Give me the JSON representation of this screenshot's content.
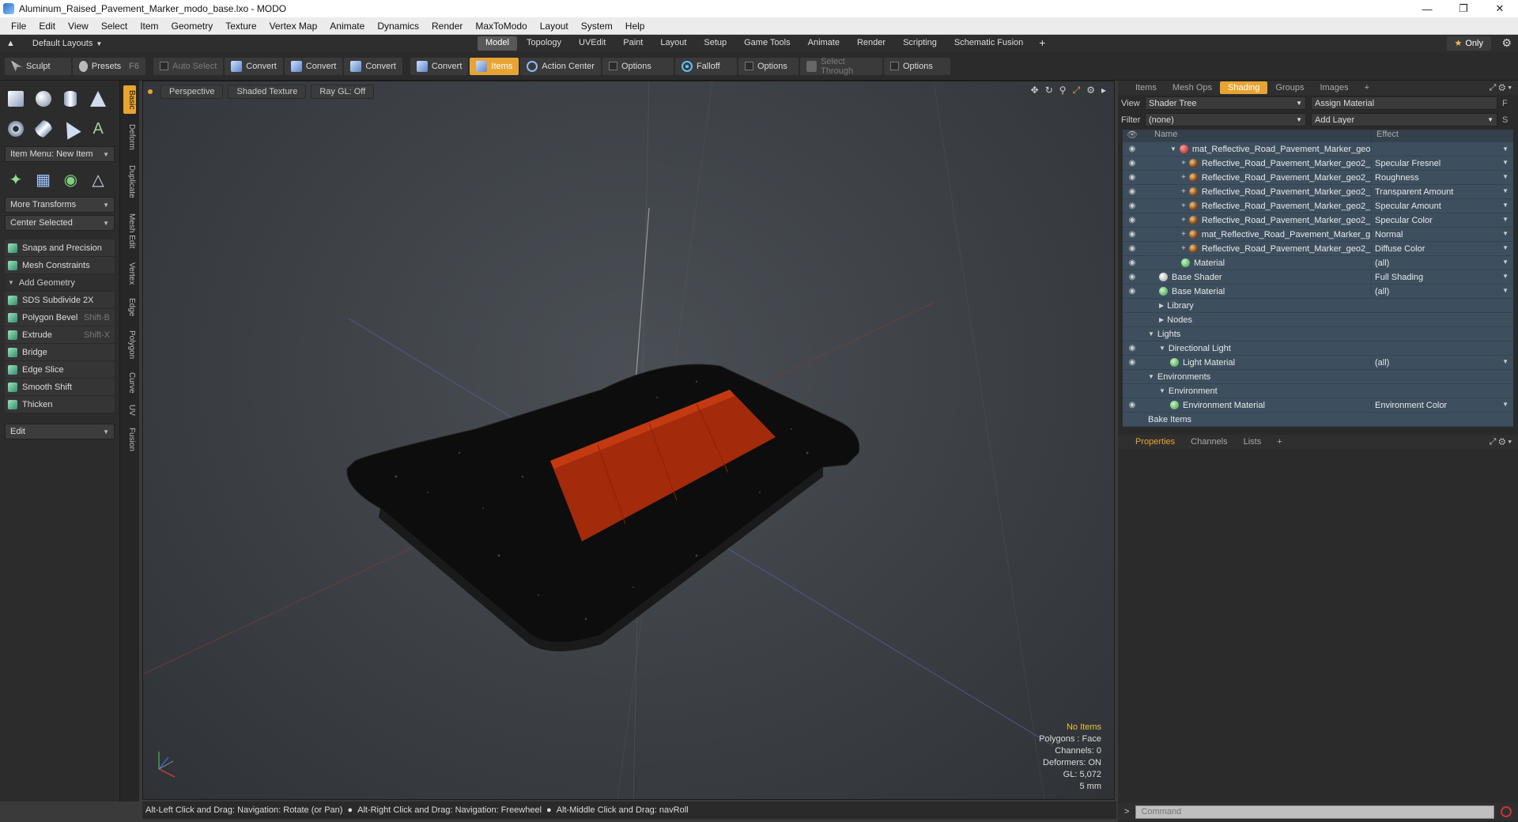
{
  "window": {
    "title": "Aluminum_Raised_Pavement_Marker_modo_base.lxo - MODO"
  },
  "menu": [
    "File",
    "Edit",
    "View",
    "Select",
    "Item",
    "Geometry",
    "Texture",
    "Vertex Map",
    "Animate",
    "Dynamics",
    "Render",
    "MaxToModo",
    "Layout",
    "System",
    "Help"
  ],
  "layoutbar": {
    "layouts_label": "Default Layouts",
    "tabs": [
      "Model",
      "Topology",
      "UVEdit",
      "Paint",
      "Layout",
      "Setup",
      "Game Tools",
      "Animate",
      "Render",
      "Scripting",
      "Schematic Fusion"
    ],
    "active_tab": "Model",
    "only_label": "Only"
  },
  "toolbar": {
    "sculpt": "Sculpt",
    "presets": "Presets",
    "presets_key": "F6",
    "auto_select": "Auto Select",
    "convert1": "Convert",
    "convert2": "Convert",
    "convert3": "Convert",
    "convert4": "Convert",
    "items": "Items",
    "action_center": "Action Center",
    "options1": "Options",
    "falloff": "Falloff",
    "options2": "Options",
    "select_through": "Select Through",
    "options3": "Options"
  },
  "toolbox": {
    "item_menu": "Item Menu: New Item",
    "more_transforms": "More Transforms",
    "center_selected": "Center Selected",
    "snaps": "Snaps and Precision",
    "mesh_constraints": "Mesh Constraints",
    "add_geometry": "Add Geometry",
    "tools": [
      {
        "label": "SDS Subdivide 2X",
        "key": ""
      },
      {
        "label": "Polygon Bevel",
        "key": "Shift-B"
      },
      {
        "label": "Extrude",
        "key": "Shift-X"
      },
      {
        "label": "Bridge",
        "key": ""
      },
      {
        "label": "Edge Slice",
        "key": ""
      },
      {
        "label": "Smooth Shift",
        "key": ""
      },
      {
        "label": "Thicken",
        "key": ""
      }
    ],
    "edit_dropdown": "Edit"
  },
  "vtabs": [
    "Basic",
    "Deform",
    "Duplicate",
    "Mesh Edit",
    "Vertex",
    "Edge",
    "Polygon",
    "Curve",
    "UV",
    "Fusion"
  ],
  "viewport": {
    "perspective": "Perspective",
    "shading": "Shaded Texture",
    "raygl": "Ray GL: Off",
    "info": {
      "no_items": "No Items",
      "polygons": "Polygons : Face",
      "channels": "Channels: 0",
      "deformers": "Deformers: ON",
      "gl": "GL: 5,072",
      "scale": "5 mm"
    }
  },
  "statusbar": {
    "s1": "Alt-Left Click and Drag: Navigation: Rotate (or Pan)",
    "s2": "Alt-Right Click and Drag: Navigation: Freewheel",
    "s3": "Alt-Middle Click and Drag: navRoll"
  },
  "rpanel": {
    "tabs": [
      "Items",
      "Mesh Ops",
      "Shading",
      "Groups",
      "Images"
    ],
    "active_tab": "Shading",
    "view_label": "View",
    "view_value": "Shader Tree",
    "assign_material": "Assign Material",
    "filter_label": "Filter",
    "filter_value": "(none)",
    "add_layer": "Add Layer",
    "col_name": "Name",
    "col_effect": "Effect",
    "rows": [
      {
        "name": "mat_Reflective_Road_Pavement_Marker_geo ...",
        "effect": "",
        "indent": 2,
        "icon": "red",
        "eye": true,
        "tri": true
      },
      {
        "name": "Reflective_Road_Pavement_Marker_geo2_ ...",
        "effect": "Specular Fresnel",
        "indent": 3,
        "icon": "layer",
        "eye": true,
        "plus": true
      },
      {
        "name": "Reflective_Road_Pavement_Marker_geo2_ ...",
        "effect": "Roughness",
        "indent": 3,
        "icon": "layer",
        "eye": true,
        "plus": true
      },
      {
        "name": "Reflective_Road_Pavement_Marker_geo2_ ...",
        "effect": "Transparent Amount",
        "indent": 3,
        "icon": "layer",
        "eye": true,
        "plus": true
      },
      {
        "name": "Reflective_Road_Pavement_Marker_geo2_ ...",
        "effect": "Specular Amount",
        "indent": 3,
        "icon": "layer",
        "eye": true,
        "plus": true
      },
      {
        "name": "Reflective_Road_Pavement_Marker_geo2_ ...",
        "effect": "Specular Color",
        "indent": 3,
        "icon": "layer",
        "eye": true,
        "plus": true
      },
      {
        "name": "mat_Reflective_Road_Pavement_Marker_g ...",
        "effect": "Normal",
        "indent": 3,
        "icon": "layer",
        "eye": true,
        "plus": true
      },
      {
        "name": "Reflective_Road_Pavement_Marker_geo2_ ...",
        "effect": "Diffuse Color",
        "indent": 3,
        "icon": "layer",
        "eye": true,
        "plus": true
      },
      {
        "name": "Material",
        "effect": "(all)",
        "indent": 3,
        "icon": "mat",
        "eye": true
      },
      {
        "name": "Base Shader",
        "effect": "Full Shading",
        "indent": 1,
        "icon": "white",
        "eye": true
      },
      {
        "name": "Base Material",
        "effect": "(all)",
        "indent": 1,
        "icon": "mat",
        "eye": true
      },
      {
        "name": "Library",
        "effect": "",
        "indent": 1,
        "icon": "",
        "folder": true
      },
      {
        "name": "Nodes",
        "effect": "",
        "indent": 1,
        "icon": "",
        "folder": true
      },
      {
        "name": "Lights",
        "effect": "",
        "indent": 0,
        "icon": "",
        "tri": true
      },
      {
        "name": "Directional Light",
        "effect": "",
        "indent": 1,
        "icon": "",
        "eye": true,
        "tri": true
      },
      {
        "name": "Light Material",
        "effect": "(all)",
        "indent": 2,
        "icon": "mat",
        "eye": true
      },
      {
        "name": "Environments",
        "effect": "",
        "indent": 0,
        "icon": "",
        "tri": true
      },
      {
        "name": "Environment",
        "effect": "",
        "indent": 1,
        "icon": "",
        "tri": true
      },
      {
        "name": "Environment Material",
        "effect": "Environment Color",
        "indent": 2,
        "icon": "mat",
        "eye": true
      },
      {
        "name": "Bake Items",
        "effect": "",
        "indent": 0,
        "icon": ""
      }
    ],
    "prop_tabs": [
      "Properties",
      "Channels",
      "Lists"
    ],
    "command_placeholder": "Command"
  }
}
